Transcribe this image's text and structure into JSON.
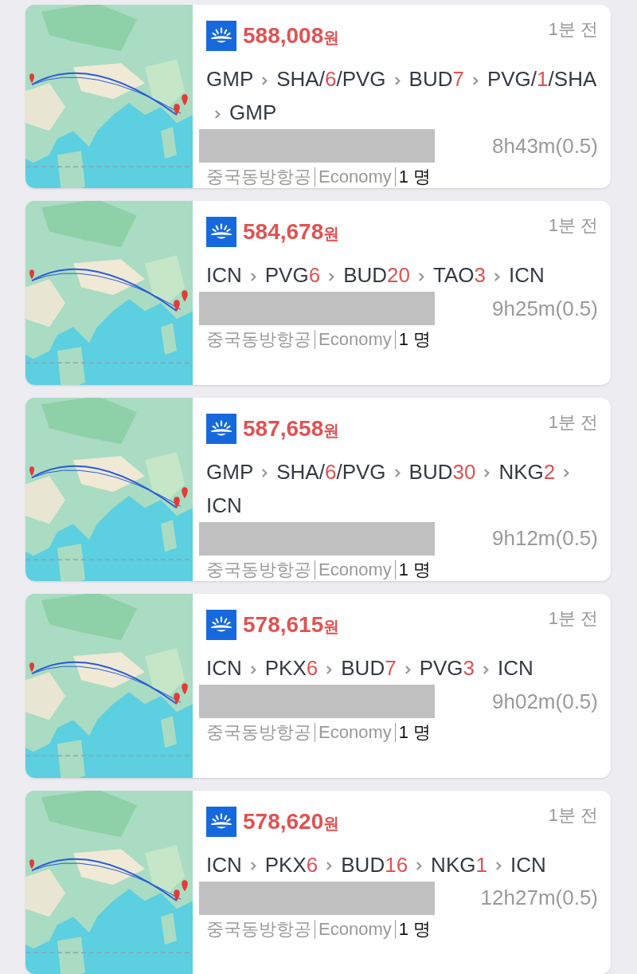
{
  "results": [
    {
      "map": {
        "kind": "picture"
      },
      "price": "588,008",
      "currency": "원",
      "age": "1분 전",
      "duration": "8h43m(0.5)",
      "airline": "중국동방항공",
      "cabin": "Economy",
      "passengers": "1 명",
      "stops": [
        [
          {
            "kind": "code",
            "text": "GMP"
          }
        ],
        [
          {
            "kind": "code",
            "text": "SHA"
          },
          {
            "kind": "sep",
            "text": "/"
          },
          {
            "kind": "stay",
            "text": "6"
          },
          {
            "kind": "sep",
            "text": "/"
          },
          {
            "kind": "code",
            "text": "PVG"
          }
        ],
        [
          {
            "kind": "code",
            "text": "BUD"
          },
          {
            "kind": "stay",
            "text": "7"
          }
        ],
        [
          {
            "kind": "code",
            "text": "PVG"
          },
          {
            "kind": "sep",
            "text": "/"
          },
          {
            "kind": "stay",
            "text": "1"
          },
          {
            "kind": "sep",
            "text": "/"
          },
          {
            "kind": "code",
            "text": "SHA"
          }
        ],
        [
          {
            "kind": "code",
            "text": "GMP"
          }
        ]
      ]
    },
    {
      "map": {
        "kind": "picture"
      },
      "price": "584,678",
      "currency": "원",
      "age": "1분 전",
      "duration": "9h25m(0.5)",
      "airline": "중국동방항공",
      "cabin": "Economy",
      "passengers": "1 명",
      "stops": [
        [
          {
            "kind": "code",
            "text": "ICN"
          }
        ],
        [
          {
            "kind": "code",
            "text": "PVG"
          },
          {
            "kind": "stay",
            "text": "6"
          }
        ],
        [
          {
            "kind": "code",
            "text": "BUD"
          },
          {
            "kind": "stay",
            "text": "20"
          }
        ],
        [
          {
            "kind": "code",
            "text": "TAO"
          },
          {
            "kind": "stay",
            "text": "3"
          }
        ],
        [
          {
            "kind": "code",
            "text": "ICN"
          }
        ]
      ]
    },
    {
      "map": {
        "kind": "picture"
      },
      "price": "587,658",
      "currency": "원",
      "age": "1분 전",
      "duration": "9h12m(0.5)",
      "airline": "중국동방항공",
      "cabin": "Economy",
      "passengers": "1 명",
      "stops": [
        [
          {
            "kind": "code",
            "text": "GMP"
          }
        ],
        [
          {
            "kind": "code",
            "text": "SHA"
          },
          {
            "kind": "sep",
            "text": "/"
          },
          {
            "kind": "stay",
            "text": "6"
          },
          {
            "kind": "sep",
            "text": "/"
          },
          {
            "kind": "code",
            "text": "PVG"
          }
        ],
        [
          {
            "kind": "code",
            "text": "BUD"
          },
          {
            "kind": "stay",
            "text": "30"
          }
        ],
        [
          {
            "kind": "code",
            "text": "NKG"
          },
          {
            "kind": "stay",
            "text": "2"
          }
        ],
        [
          {
            "kind": "code",
            "text": "ICN"
          }
        ]
      ]
    },
    {
      "map": {
        "kind": "picture"
      },
      "price": "578,615",
      "currency": "원",
      "age": "1분 전",
      "duration": "9h02m(0.5)",
      "airline": "중국동방항공",
      "cabin": "Economy",
      "passengers": "1 명",
      "stops": [
        [
          {
            "kind": "code",
            "text": "ICN"
          }
        ],
        [
          {
            "kind": "code",
            "text": "PKX"
          },
          {
            "kind": "stay",
            "text": "6"
          }
        ],
        [
          {
            "kind": "code",
            "text": "BUD"
          },
          {
            "kind": "stay",
            "text": "7"
          }
        ],
        [
          {
            "kind": "code",
            "text": "PVG"
          },
          {
            "kind": "stay",
            "text": "3"
          }
        ],
        [
          {
            "kind": "code",
            "text": "ICN"
          }
        ]
      ]
    },
    {
      "map": {
        "kind": "picture"
      },
      "price": "578,620",
      "currency": "원",
      "age": "1분 전",
      "duration": "12h27m(0.5)",
      "airline": "중국동방항공",
      "cabin": "Economy",
      "passengers": "1 명",
      "stops": [
        [
          {
            "kind": "code",
            "text": "ICN"
          }
        ],
        [
          {
            "kind": "code",
            "text": "PKX"
          },
          {
            "kind": "stay",
            "text": "6"
          }
        ],
        [
          {
            "kind": "code",
            "text": "BUD"
          },
          {
            "kind": "stay",
            "text": "16"
          }
        ],
        [
          {
            "kind": "code",
            "text": "NKG"
          },
          {
            "kind": "stay",
            "text": "1"
          }
        ],
        [
          {
            "kind": "code",
            "text": "ICN"
          }
        ]
      ]
    }
  ]
}
